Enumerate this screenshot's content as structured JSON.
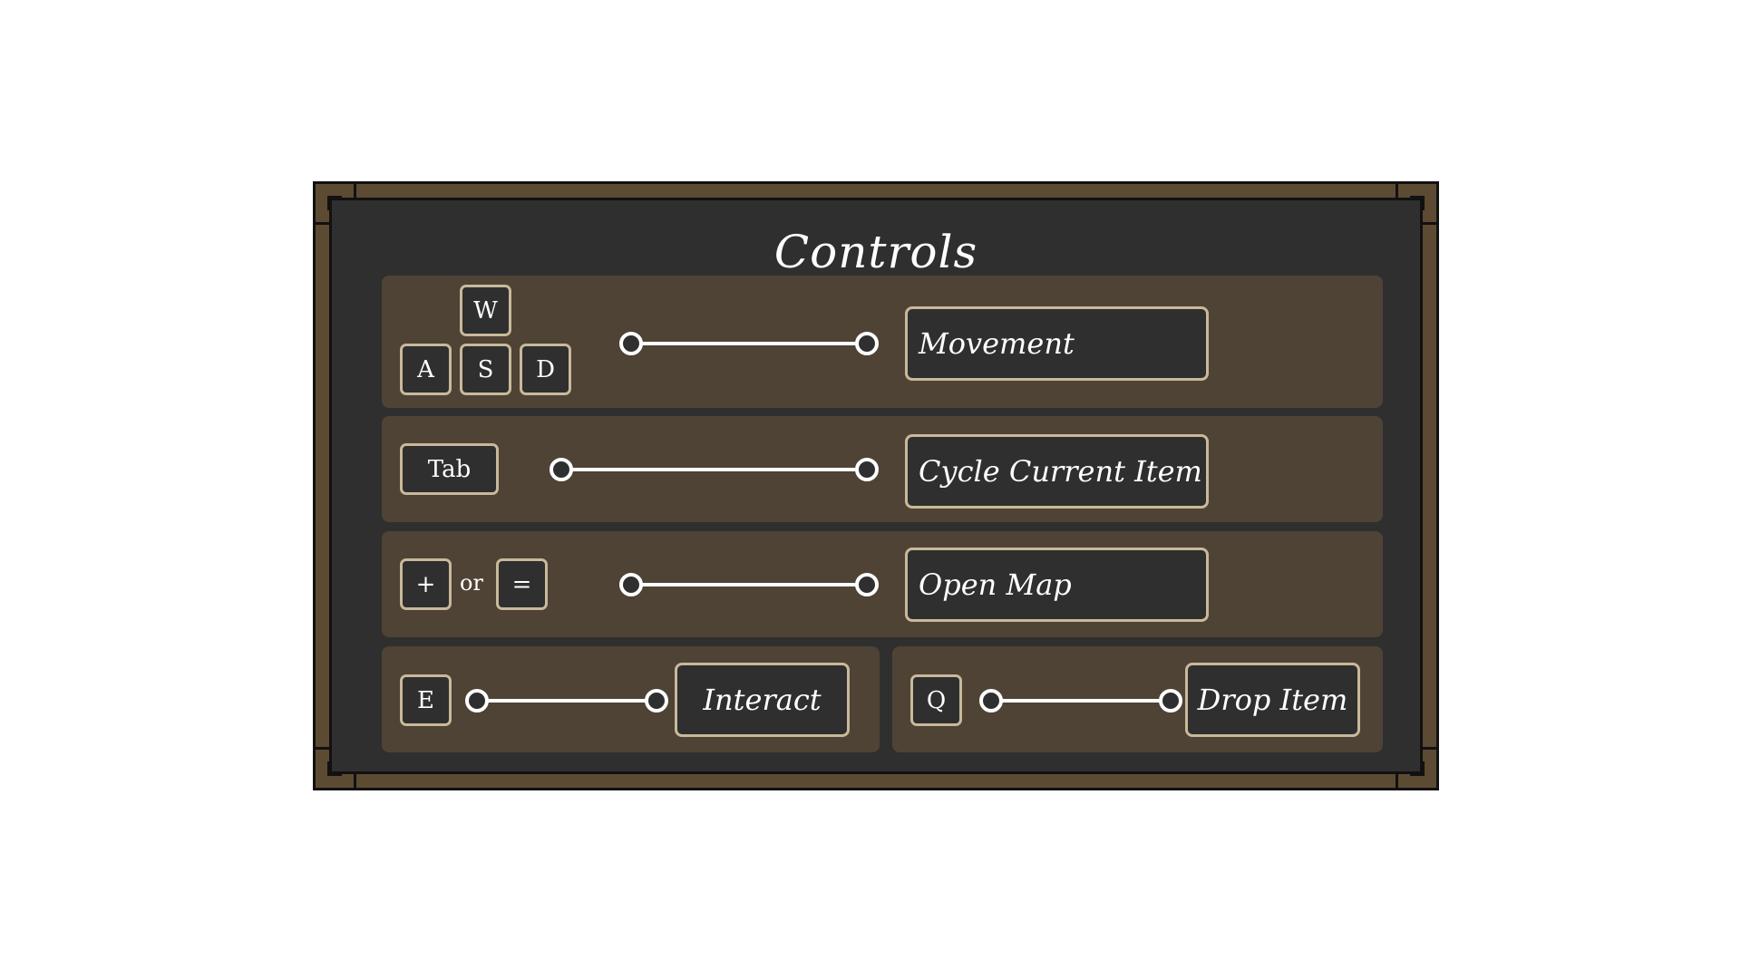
{
  "panel": {
    "title": "Controls",
    "colors": {
      "frame": "#5c4a32",
      "panel_bg": "#2f2f2f",
      "row_bg": "#4e4335",
      "key_border": "#c9b99a",
      "text": "#ffffff"
    }
  },
  "bindings": {
    "movement": {
      "keys": [
        "W",
        "A",
        "S",
        "D"
      ],
      "action": "Movement"
    },
    "cycle": {
      "key": "Tab",
      "action": "Cycle Current Item"
    },
    "map": {
      "key_1": "+",
      "separator": "or",
      "key_2": "=",
      "action": "Open Map"
    },
    "interact": {
      "key": "E",
      "action": "Interact"
    },
    "drop": {
      "key": "Q",
      "action": "Drop Item"
    }
  }
}
